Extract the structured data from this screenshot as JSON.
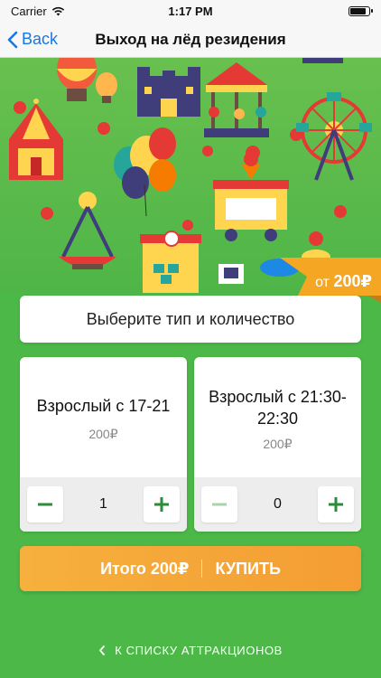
{
  "status_bar": {
    "carrier": "Carrier",
    "time": "1:17 PM",
    "battery_level": 0.95
  },
  "nav": {
    "back_label": "Back",
    "title": "Выход на лёд резидения"
  },
  "hero": {
    "price_prefix": "от",
    "price_value": "200₽"
  },
  "select": {
    "label": "Выберите тип и количество"
  },
  "tickets": [
    {
      "title": "Взрослый с 17-21",
      "price": "200₽",
      "quantity": "1",
      "minus_enabled": true
    },
    {
      "title": "Взрослый с 21:30-22:30",
      "price": "200₽",
      "quantity": "0",
      "minus_enabled": false
    }
  ],
  "buy": {
    "total": "Итого 200₽",
    "action": "КУПИТЬ"
  },
  "footer": {
    "link": "К СПИСКУ АТТРАКЦИОНОВ"
  },
  "colors": {
    "accent_blue": "#1677e8",
    "background_green": "#4cb848",
    "buy_orange": "#f49d33",
    "stepper_green": "#2e8b3a"
  },
  "icons": [
    "wifi-icon",
    "battery-icon",
    "back-chevron-icon",
    "minus-icon",
    "plus-icon",
    "chevron-left-icon"
  ]
}
